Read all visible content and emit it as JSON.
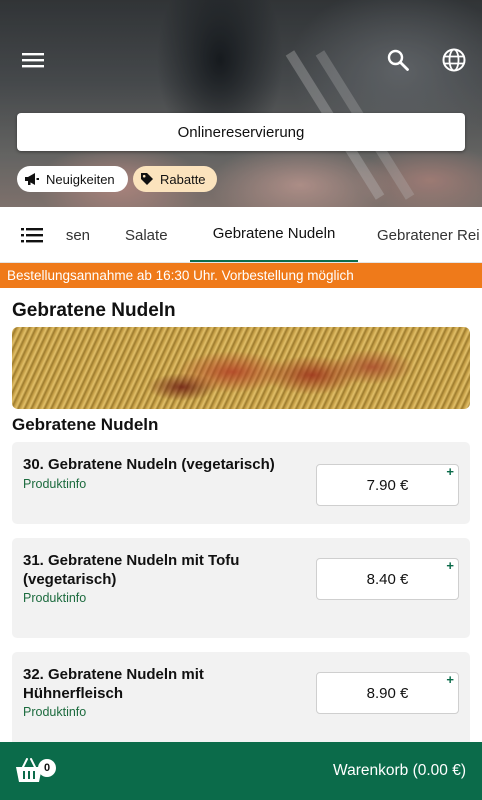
{
  "header": {
    "reservation_label": "Onlinereservierung",
    "chips": {
      "news": "Neuigkeiten",
      "discounts": "Rabatte"
    }
  },
  "icons": {
    "menu": "menu-icon",
    "search": "search-icon",
    "language": "globe-icon",
    "news": "megaphone-icon",
    "discounts": "tag-icon",
    "category_list": "list-icon",
    "cart": "basket-icon"
  },
  "tabs": {
    "partial_left": "sen",
    "items": [
      "Salate",
      "Gebratene Nudeln",
      "Gebratener Rei"
    ],
    "active_index": 1
  },
  "notice": "Bestellungsannahme ab 16:30 Uhr. Vorbestellung möglich",
  "section": {
    "title": "Gebratene Nudeln",
    "subtitle": "Gebratene Nudeln",
    "products": [
      {
        "name": "30. Gebratene Nudeln (vegetarisch)",
        "info": "Produktinfo",
        "price": "7.90 €",
        "add": "+"
      },
      {
        "name": "31. Gebratene Nudeln mit Tofu (vegetarisch)",
        "info": "Produktinfo",
        "price": "8.40 €",
        "add": "+"
      },
      {
        "name": "32. Gebratene Nudeln mit Hühnerfleisch",
        "info": "Produktinfo",
        "price": "8.90 €",
        "add": "+"
      }
    ]
  },
  "cart": {
    "count": "0",
    "label": "Warenkorb (0.00 €)"
  },
  "colors": {
    "brand_green": "#0b6b4a",
    "notice_orange": "#ef7a1a",
    "discount_chip": "#fbe3bd",
    "info_green": "#1c6b3e"
  }
}
